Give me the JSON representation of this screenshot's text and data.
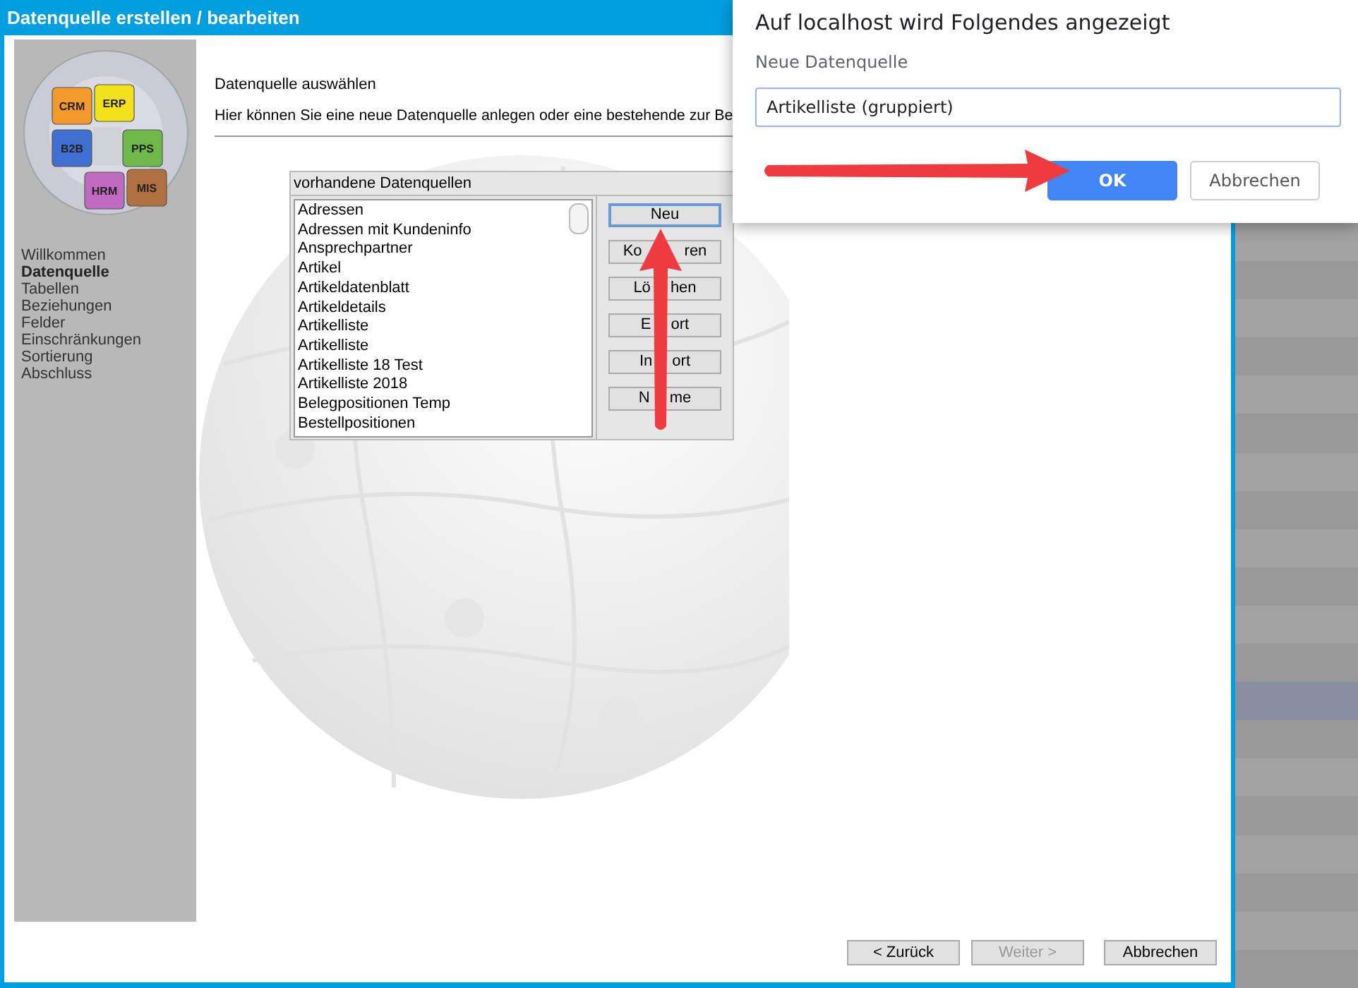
{
  "window": {
    "title": "Datenquelle erstellen / bearbeiten"
  },
  "logo": {
    "labels": [
      "CRM",
      "ERP",
      "B2B",
      "PPS",
      "HRM",
      "MIS"
    ]
  },
  "sidebar": {
    "items": [
      {
        "label": "Willkommen",
        "selected": false
      },
      {
        "label": "Datenquelle",
        "selected": true
      },
      {
        "label": "Tabellen",
        "selected": false
      },
      {
        "label": "Beziehungen",
        "selected": false
      },
      {
        "label": "Felder",
        "selected": false
      },
      {
        "label": "Einschränkungen",
        "selected": false
      },
      {
        "label": "Sortierung",
        "selected": false
      },
      {
        "label": "Abschluss",
        "selected": false
      }
    ]
  },
  "page": {
    "heading": "Datenquelle auswählen",
    "description": "Hier können Sie eine neue Datenquelle anlegen oder eine bestehende zur Be"
  },
  "datasources": {
    "title": "vorhandene Datenquellen",
    "items": [
      "Adressen",
      "Adressen mit Kundeninfo",
      "Ansprechpartner",
      "Artikel",
      "Artikeldatenblatt",
      "Artikeldetails",
      "Artikelliste",
      "Artikelliste",
      "Artikelliste 18 Test",
      "Artikelliste 2018",
      "Belegpositionen Temp",
      "Bestellpositionen"
    ],
    "buttons": [
      {
        "label_parts": [
          "Neu"
        ],
        "focused": true
      },
      {
        "label_parts": [
          "Ko",
          "ren"
        ],
        "focused": false
      },
      {
        "label_parts": [
          "Lö",
          "hen"
        ],
        "focused": false
      },
      {
        "label_parts": [
          "E",
          "ort"
        ],
        "focused": false
      },
      {
        "label_parts": [
          "In",
          "ort"
        ],
        "focused": false
      },
      {
        "label_parts": [
          "N",
          "me"
        ],
        "focused": false
      }
    ]
  },
  "footer_buttons": [
    {
      "label": "< Zurück",
      "disabled": false
    },
    {
      "label": "Weiter >",
      "disabled": true
    },
    {
      "label": "Abbrechen",
      "disabled": false
    }
  ],
  "prompt": {
    "title": "Auf localhost wird Folgendes angezeigt",
    "label": "Neue Datenquelle",
    "value": "Artikelliste (gruppiert)",
    "buttons": [
      {
        "label": "OK",
        "kind": "primary"
      },
      {
        "label": "Abbrechen",
        "kind": "secondary"
      }
    ]
  }
}
